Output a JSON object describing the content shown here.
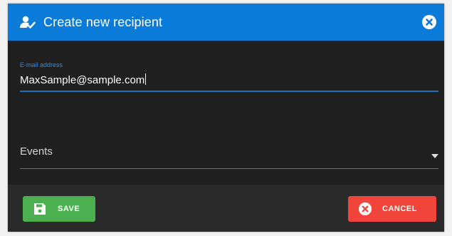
{
  "dialog": {
    "title": "Create new recipient",
    "icons": {
      "header": "add-user-icon",
      "close": "close-icon"
    }
  },
  "form": {
    "email": {
      "label": "E-mail address",
      "value": "MaxSample@sample.com"
    },
    "events": {
      "label": "Events",
      "icon": "dropdown-arrow-icon"
    }
  },
  "footer": {
    "save_label": "SAVE",
    "save_icon": "floppy-disk-icon",
    "cancel_label": "CANCEL",
    "cancel_icon": "close-circle-icon"
  },
  "colors": {
    "header": "#0a7bd8",
    "body": "#1f1f1f",
    "footer": "#2a2a2a",
    "save": "#4caf50",
    "cancel": "#f1453b",
    "accent": "#2f8be0"
  }
}
